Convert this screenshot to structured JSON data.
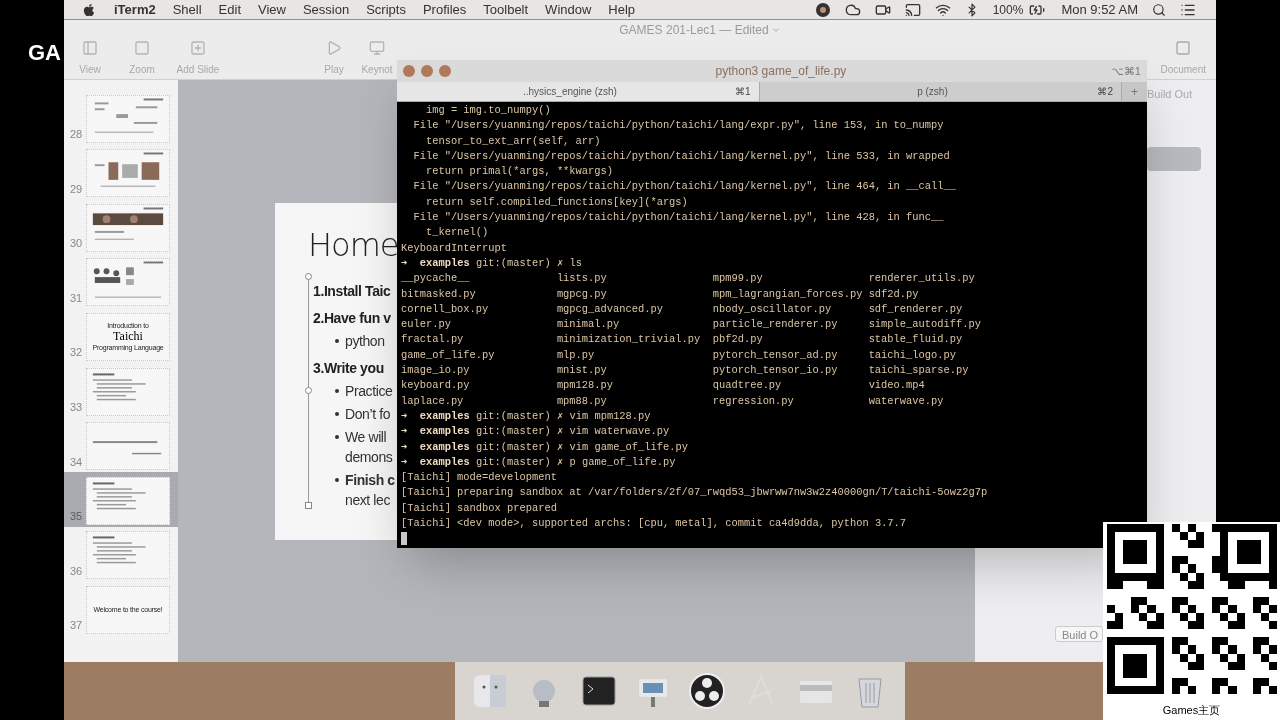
{
  "overlay": {
    "channel_mark": "GA",
    "qr_caption": "Games主页"
  },
  "menubar": {
    "menus": [
      {
        "kind": "app",
        "label": "iTerm2"
      },
      {
        "kind": "menu",
        "label": "Shell"
      },
      {
        "kind": "menu",
        "label": "Edit"
      },
      {
        "kind": "menu",
        "label": "View"
      },
      {
        "kind": "menu",
        "label": "Session"
      },
      {
        "kind": "menu",
        "label": "Scripts"
      },
      {
        "kind": "menu",
        "label": "Profiles"
      },
      {
        "kind": "menu",
        "label": "Toolbelt"
      },
      {
        "kind": "menu",
        "label": "Window"
      },
      {
        "kind": "menu",
        "label": "Help"
      }
    ],
    "battery": "100%",
    "clock": "Mon 9:52 AM"
  },
  "keynote": {
    "title": "GAMES 201-Lec1 — Edited",
    "toolbar": [
      {
        "kind": "view",
        "label": "View"
      },
      {
        "kind": "zoom",
        "label": "Zoom"
      },
      {
        "kind": "add",
        "label": "Add Slide"
      },
      {
        "kind": "play",
        "label": "Play"
      },
      {
        "kind": "live",
        "label": "Keynot"
      }
    ],
    "document_label": "Document",
    "build_out_tab": "Build Out",
    "build_out_button": "Build O",
    "slides": [
      {
        "number": "28",
        "kind": "diagram",
        "selected": false
      },
      {
        "number": "29",
        "kind": "figure",
        "selected": false
      },
      {
        "number": "30",
        "kind": "photo",
        "selected": false
      },
      {
        "number": "31",
        "kind": "people",
        "selected": false
      },
      {
        "number": "32",
        "kind": "title",
        "selected": false,
        "lines": [
          "Introduction to",
          "Taichi",
          "Programming Language"
        ]
      },
      {
        "number": "33",
        "kind": "list",
        "selected": false
      },
      {
        "number": "34",
        "kind": "quote",
        "selected": false
      },
      {
        "number": "35",
        "kind": "list",
        "selected": true
      },
      {
        "number": "36",
        "kind": "list",
        "selected": false
      },
      {
        "number": "37",
        "kind": "title",
        "selected": false,
        "lines": [
          "Welcome to the course!"
        ]
      }
    ],
    "slide": {
      "title": "Home",
      "items": [
        {
          "kind": "heading",
          "lines": [
            "1.Install Taic"
          ]
        },
        {
          "kind": "heading",
          "lines": [
            "2.Have fun v"
          ]
        },
        {
          "kind": "bullet",
          "lines": [
            "python"
          ]
        },
        {
          "kind": "heading",
          "lines": [
            "3.Write you"
          ]
        },
        {
          "kind": "bullet",
          "lines": [
            "Practice"
          ]
        },
        {
          "kind": "bullet",
          "lines": [
            "Don’t fo"
          ]
        },
        {
          "kind": "bullet",
          "lines": [
            "We will",
            "demons"
          ]
        },
        {
          "kind": "bullet",
          "lines": [
            "**Finish c**",
            "next lec"
          ]
        }
      ]
    }
  },
  "terminal": {
    "title": "python3 game_of_life.py",
    "title_shortcut": "⌥⌘1",
    "tabs": [
      {
        "label": "..hysics_engine (zsh)",
        "shortcut": "⌘1",
        "selected": true
      },
      {
        "label": "p (zsh)",
        "shortcut": "⌘2",
        "selected": false
      }
    ],
    "new_tab": "+",
    "lines": [
      {
        "kind": "text",
        "text": "    img = img.to_numpy()"
      },
      {
        "kind": "text",
        "text": "  File \"/Users/yuanming/repos/taichi/python/taichi/lang/expr.py\", line 153, in to_numpy"
      },
      {
        "kind": "text",
        "text": "    tensor_to_ext_arr(self, arr)"
      },
      {
        "kind": "text",
        "text": "  File \"/Users/yuanming/repos/taichi/python/taichi/lang/kernel.py\", line 533, in wrapped"
      },
      {
        "kind": "text",
        "text": "    return primal(*args, **kwargs)"
      },
      {
        "kind": "text",
        "text": "  File \"/Users/yuanming/repos/taichi/python/taichi/lang/kernel.py\", line 464, in __call__"
      },
      {
        "kind": "text",
        "text": "    return self.compiled_functions[key](*args)"
      },
      {
        "kind": "text",
        "text": "  File \"/Users/yuanming/repos/taichi/python/taichi/lang/kernel.py\", line 428, in func__"
      },
      {
        "kind": "text",
        "text": "    t_kernel()"
      },
      {
        "kind": "text",
        "text": "KeyboardInterrupt"
      },
      {
        "kind": "prompt",
        "arrow": "➜",
        "dir": "examples",
        "branch": "git:(master)",
        "dirty": "✗",
        "command": "ls"
      },
      {
        "kind": "ls",
        "cells": [
          "__pycache__",
          "lists.py",
          "mpm99.py",
          "renderer_utils.py"
        ]
      },
      {
        "kind": "ls",
        "cells": [
          "bitmasked.py",
          "mgpcg.py",
          "mpm_lagrangian_forces.py",
          "sdf2d.py"
        ]
      },
      {
        "kind": "ls",
        "cells": [
          "cornell_box.py",
          "mgpcg_advanced.py",
          "nbody_oscillator.py",
          "sdf_renderer.py"
        ]
      },
      {
        "kind": "ls",
        "cells": [
          "euler.py",
          "minimal.py",
          "particle_renderer.py",
          "simple_autodiff.py"
        ]
      },
      {
        "kind": "ls",
        "cells": [
          "fractal.py",
          "minimization_trivial.py",
          "pbf2d.py",
          "stable_fluid.py"
        ]
      },
      {
        "kind": "ls",
        "cells": [
          "game_of_life.py",
          "mlp.py",
          "pytorch_tensor_ad.py",
          "taichi_logo.py"
        ]
      },
      {
        "kind": "ls",
        "cells": [
          "image_io.py",
          "mnist.py",
          "pytorch_tensor_io.py",
          "taichi_sparse.py"
        ]
      },
      {
        "kind": "ls",
        "cells": [
          "keyboard.py",
          "mpm128.py",
          "quadtree.py",
          "video.mp4"
        ]
      },
      {
        "kind": "ls",
        "cells": [
          "laplace.py",
          "mpm88.py",
          "regression.py",
          "waterwave.py"
        ]
      },
      {
        "kind": "prompt",
        "arrow": "➜",
        "dir": "examples",
        "branch": "git:(master)",
        "dirty": "✗",
        "command": "vim mpm128.py"
      },
      {
        "kind": "prompt",
        "arrow": "➜",
        "dir": "examples",
        "branch": "git:(master)",
        "dirty": "✗",
        "command": "vim waterwave.py"
      },
      {
        "kind": "prompt",
        "arrow": "➜",
        "dir": "examples",
        "branch": "git:(master)",
        "dirty": "✗",
        "command": "vim game_of_life.py"
      },
      {
        "kind": "prompt",
        "arrow": "➜",
        "dir": "examples",
        "branch": "git:(master)",
        "dirty": "✗",
        "command": "p game_of_life.py"
      },
      {
        "kind": "text",
        "text": "[Taichi] mode=development"
      },
      {
        "kind": "text",
        "text": "[Taichi] preparing sandbox at /var/folders/2f/07_rwqd53_jbwrww7nw3w2z40000gn/T/taichi-5owz2g7p"
      },
      {
        "kind": "text",
        "text": "[Taichi] sandbox prepared"
      },
      {
        "kind": "text",
        "text": "[Taichi] <dev mode>, supported archs: [cpu, metal], commit ca4d9dda, python 3.7.7"
      },
      {
        "kind": "cursor"
      }
    ]
  }
}
